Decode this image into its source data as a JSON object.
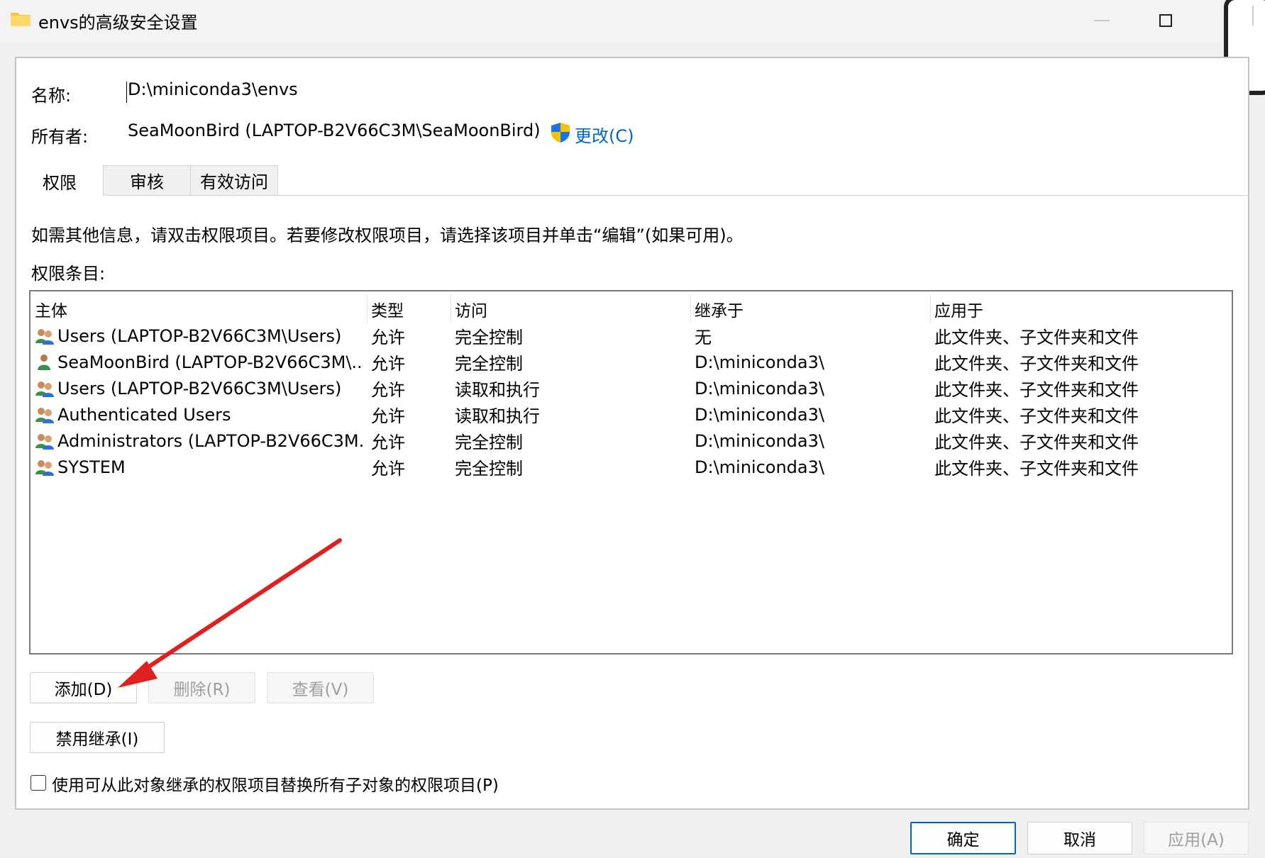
{
  "window": {
    "title": "envs的高级安全设置"
  },
  "info": {
    "name_label": "名称:",
    "name_value": "D:\\miniconda3\\envs",
    "owner_label": "所有者:",
    "owner_value": "SeaMoonBird (LAPTOP-B2V66C3M\\SeaMoonBird)",
    "change_link": "更改(C)"
  },
  "tabs": [
    "权限",
    "审核",
    "有效访问"
  ],
  "description": "如需其他信息，请双击权限项目。若要修改权限项目，请选择该项目并单击“编辑”(如果可用)。",
  "entries_label": "权限条目:",
  "table": {
    "columns": [
      "主体",
      "类型",
      "访问",
      "继承于",
      "应用于"
    ],
    "rows": [
      {
        "principal": "Users (LAPTOP-B2V66C3M\\Users)",
        "type": "允许",
        "access": "完全控制",
        "inherited": "无",
        "applies": "此文件夹、子文件夹和文件",
        "icon": "group-users-icon"
      },
      {
        "principal": "SeaMoonBird (LAPTOP-B2V66C3M\\...",
        "type": "允许",
        "access": "完全控制",
        "inherited": "D:\\miniconda3\\",
        "applies": "此文件夹、子文件夹和文件",
        "icon": "single-user-icon"
      },
      {
        "principal": "Users (LAPTOP-B2V66C3M\\Users)",
        "type": "允许",
        "access": "读取和执行",
        "inherited": "D:\\miniconda3\\",
        "applies": "此文件夹、子文件夹和文件",
        "icon": "group-users-icon"
      },
      {
        "principal": "Authenticated Users",
        "type": "允许",
        "access": "读取和执行",
        "inherited": "D:\\miniconda3\\",
        "applies": "此文件夹、子文件夹和文件",
        "icon": "group-users-icon"
      },
      {
        "principal": "Administrators (LAPTOP-B2V66C3M...",
        "type": "允许",
        "access": "完全控制",
        "inherited": "D:\\miniconda3\\",
        "applies": "此文件夹、子文件夹和文件",
        "icon": "group-users-icon"
      },
      {
        "principal": "SYSTEM",
        "type": "允许",
        "access": "完全控制",
        "inherited": "D:\\miniconda3\\",
        "applies": "此文件夹、子文件夹和文件",
        "icon": "group-users-icon"
      }
    ]
  },
  "buttons": {
    "add": "添加(D)",
    "remove": "删除(R)",
    "view": "查看(V)",
    "disable_inheritance": "禁用继承(I)"
  },
  "replace_checkbox": {
    "label": "使用可从此对象继承的权限项目替换所有子对象的权限项目(P)",
    "checked": false
  },
  "footer": {
    "ok": "确定",
    "cancel": "取消",
    "apply": "应用(A)"
  },
  "colors": {
    "accent": "#0067c0",
    "arrow": "#e02020"
  }
}
